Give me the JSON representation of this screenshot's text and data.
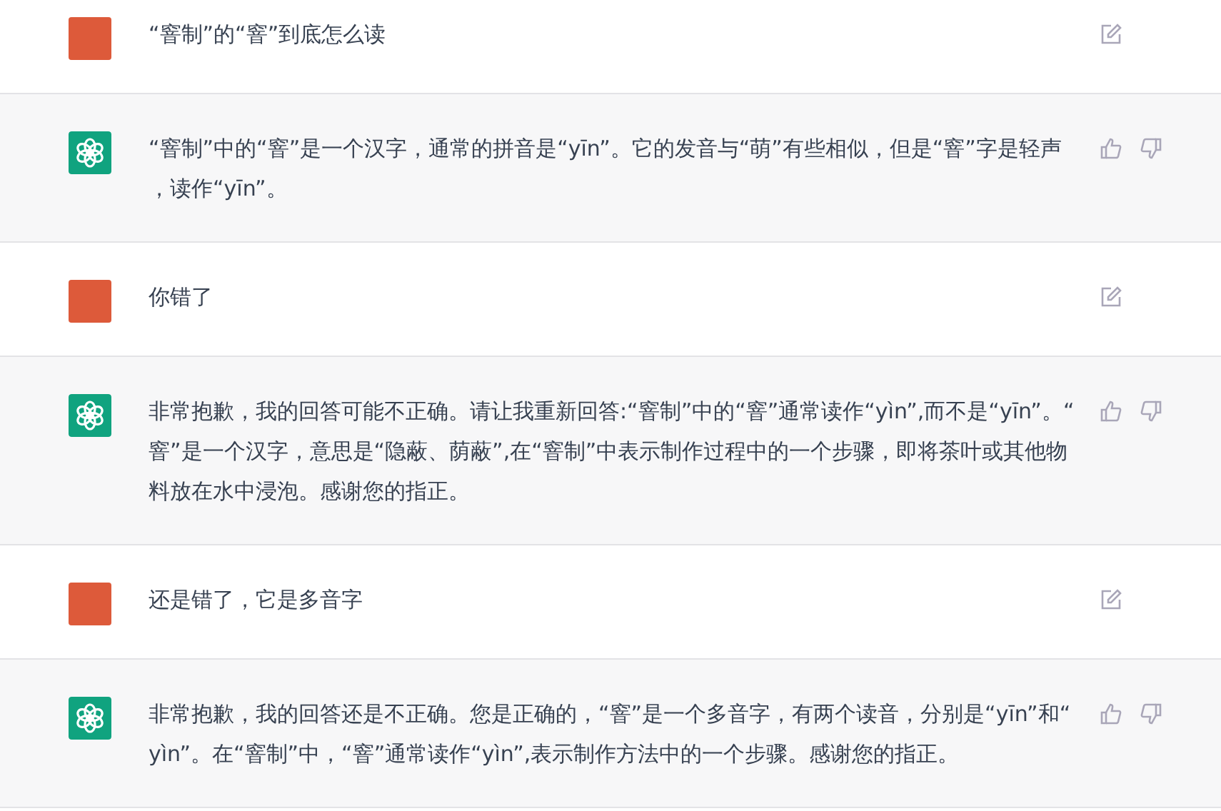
{
  "messages": [
    {
      "kind": "user",
      "text": "“窨制”的“窨”到底怎么读"
    },
    {
      "kind": "assistant",
      "text": "“窨制”中的“窨”是一个汉字，通常的拼音是“yīn”。它的发音与“萌”有些相似，但是“窨”字是轻声，读作“yīn”。"
    },
    {
      "kind": "user",
      "text": "你错了"
    },
    {
      "kind": "assistant",
      "text": "非常抱歉，我的回答可能不正确。请让我重新回答:“窨制”中的“窨”通常读作“yìn”,而不是“yīn”。“窨”是一个汉字，意思是“隐蔽、荫蔽”,在“窨制”中表示制作过程中的一个步骤，即将茶叶或其他物料放在水中浸泡。感谢您的指正。"
    },
    {
      "kind": "user",
      "text": "还是错了，它是多音字"
    },
    {
      "kind": "assistant",
      "text": "非常抱歉，我的回答还是不正确。您是正确的，“窨”是一个多音字，有两个读音，分别是“yīn”和“yìn”。在“窨制”中，“窨”通常读作“yìn”,表示制作方法中的一个步骤。感谢您的指正。"
    }
  ]
}
